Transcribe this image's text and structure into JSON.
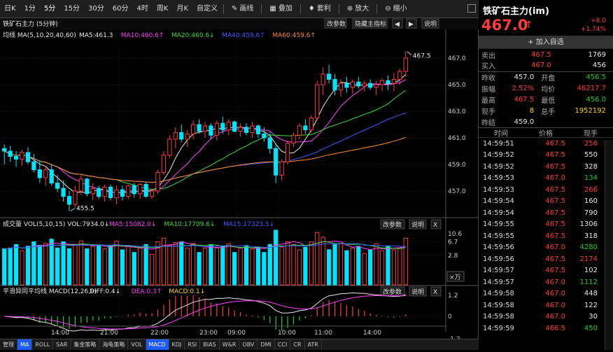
{
  "toolbar": {
    "periods": [
      "日K",
      "1分",
      "5分",
      "15分",
      "30分",
      "60分",
      "4时",
      "周K",
      "月K",
      "自定义"
    ],
    "active": "5分",
    "tools": [
      {
        "icon": "line-draw-icon",
        "label": "画线"
      },
      {
        "icon": "overlay-icon",
        "label": "叠加"
      },
      {
        "icon": "arbitrage-icon",
        "label": "套利"
      },
      {
        "icon": "zoom-in-icon",
        "label": "放大"
      },
      {
        "icon": "zoom-out-icon",
        "label": "缩小"
      }
    ]
  },
  "main_panel": {
    "title": "铁矿石主力 (5分钟)",
    "buttons": [
      "改参数",
      "隐藏主指标",
      "说明"
    ],
    "ma_legend": {
      "name": "均线 MA(5,10,20,40,60)",
      "items": [
        {
          "label": "MA5:461.3",
          "color": "#e8e8e8"
        },
        {
          "label": "MA10:460.6↑",
          "color": "#ff40ff"
        },
        {
          "label": "MA20:460.6↓",
          "color": "#3cdc3c"
        },
        {
          "label": "MA40:459.6↑",
          "color": "#3d5bff"
        },
        {
          "label": "MA60:459.6↑",
          "color": "#ff8c2a"
        }
      ]
    },
    "yticks": [
      "467.0",
      "465.0",
      "463.0",
      "461.0",
      "459.0",
      "457.0"
    ],
    "high_label": "467.5",
    "low_label": "455.5"
  },
  "vol_panel": {
    "title": "成交量 VOL(5,10,15) VOL:7934.0↓",
    "items": [
      {
        "label": "MA5:15082.0↓",
        "color": "#ff40ff"
      },
      {
        "label": "MA10:17709.6↓",
        "color": "#3cdc3c"
      },
      {
        "label": "MA15:17323.5↓",
        "color": "#3d5bff"
      }
    ],
    "buttons": [
      "改参数",
      "说明",
      "X"
    ],
    "yticks": [
      "10.6",
      "6.7",
      "2.8"
    ],
    "unit": "×万"
  },
  "macd_panel": {
    "title": "平滑异同平均线 MACD(12,26,9)",
    "items": [
      {
        "label": "DIFF:0.4↓",
        "color": "#e8e8e8"
      },
      {
        "label": "DEA:0.3↑",
        "color": "#ff40ff"
      },
      {
        "label": "MACD:0.1↓",
        "color": "#ffd200"
      }
    ],
    "buttons": [
      "改参数",
      "说明",
      "X"
    ],
    "yticks": [
      "1.2",
      "0",
      "-1.2"
    ]
  },
  "xticks": [
    "14:00",
    "21:00",
    "22:00",
    "23:00",
    "09:00",
    "10:00",
    "11:00",
    "14:00"
  ],
  "bottom_tabs": [
    "管理",
    "MA",
    "ROLL",
    "SAR",
    "集金策略",
    "海龟策略",
    "VOL",
    "MACD",
    "KDJ",
    "RSI",
    "BIAS",
    "W&R",
    "OBV",
    "DMI",
    "CCI",
    "CR",
    "ATR"
  ],
  "bottom_active": [
    "MA",
    "MACD"
  ],
  "chart_data": {
    "type": "candlestick",
    "title": "铁矿石主力 (5分钟)",
    "candles": [
      [
        460.2,
        460.5,
        459.0,
        460.0
      ],
      [
        460.0,
        460.4,
        459.2,
        459.6
      ],
      [
        459.6,
        460.0,
        458.8,
        459.4
      ],
      [
        459.4,
        460.1,
        458.9,
        459.9
      ],
      [
        459.9,
        460.3,
        459.0,
        459.2
      ],
      [
        459.2,
        459.8,
        458.4,
        458.6
      ],
      [
        458.6,
        459.3,
        457.6,
        458.0
      ],
      [
        458.0,
        458.9,
        457.4,
        458.6
      ],
      [
        458.6,
        459.0,
        457.4,
        457.6
      ],
      [
        457.6,
        458.2,
        456.9,
        457.2
      ],
      [
        457.2,
        457.8,
        456.2,
        456.6
      ],
      [
        456.6,
        457.0,
        455.5,
        456.0
      ],
      [
        456.0,
        457.4,
        455.8,
        457.0
      ],
      [
        457.0,
        458.3,
        456.7,
        457.9
      ],
      [
        457.9,
        458.0,
        456.6,
        456.8
      ],
      [
        456.8,
        457.6,
        456.3,
        457.2
      ],
      [
        457.2,
        457.4,
        456.4,
        456.6
      ],
      [
        456.6,
        457.5,
        456.2,
        457.3
      ],
      [
        457.3,
        457.5,
        456.3,
        456.5
      ],
      [
        456.5,
        457.4,
        456.0,
        457.1
      ],
      [
        457.1,
        457.4,
        456.3,
        456.6
      ],
      [
        456.6,
        457.5,
        456.4,
        457.4
      ],
      [
        457.4,
        457.6,
        456.5,
        456.8
      ],
      [
        456.8,
        457.6,
        456.4,
        457.5
      ],
      [
        457.5,
        457.7,
        456.5,
        456.6
      ],
      [
        456.6,
        457.2,
        456.4,
        457.0
      ],
      [
        457.0,
        458.6,
        456.8,
        458.4
      ],
      [
        458.4,
        460.0,
        458.2,
        459.7
      ],
      [
        459.7,
        461.2,
        459.5,
        460.9
      ],
      [
        460.9,
        461.8,
        460.2,
        461.4
      ],
      [
        461.4,
        462.0,
        460.7,
        460.9
      ],
      [
        460.9,
        461.6,
        460.3,
        461.3
      ],
      [
        461.3,
        462.3,
        460.9,
        462.0
      ],
      [
        462.0,
        462.4,
        461.3,
        461.5
      ],
      [
        461.5,
        462.2,
        461.0,
        461.9
      ],
      [
        461.9,
        462.1,
        460.9,
        461.2
      ],
      [
        461.2,
        462.3,
        460.8,
        462.1
      ],
      [
        462.1,
        462.6,
        461.3,
        461.6
      ],
      [
        461.6,
        462.4,
        461.2,
        462.2
      ],
      [
        462.2,
        462.3,
        461.4,
        461.5
      ],
      [
        461.5,
        462.1,
        461.1,
        461.8
      ],
      [
        461.8,
        462.1,
        461.2,
        461.4
      ],
      [
        461.4,
        462.2,
        461.0,
        461.9
      ],
      [
        461.9,
        462.0,
        461.0,
        461.3
      ],
      [
        461.3,
        461.8,
        460.7,
        461.0
      ],
      [
        461.0,
        461.4,
        459.8,
        460.2
      ],
      [
        460.2,
        460.6,
        457.6,
        458.2
      ],
      [
        458.2,
        459.4,
        457.8,
        459.2
      ],
      [
        459.2,
        460.8,
        459.0,
        460.6
      ],
      [
        460.6,
        461.4,
        460.3,
        461.2
      ],
      [
        461.2,
        462.1,
        460.9,
        461.9
      ],
      [
        461.9,
        462.4,
        461.3,
        461.6
      ],
      [
        461.6,
        462.7,
        461.4,
        462.5
      ],
      [
        462.5,
        465.3,
        462.3,
        465.0
      ],
      [
        465.0,
        466.3,
        464.2,
        465.8
      ],
      [
        465.8,
        466.5,
        465.1,
        465.4
      ],
      [
        465.4,
        465.8,
        464.2,
        464.6
      ],
      [
        464.6,
        465.4,
        464.1,
        465.1
      ],
      [
        465.1,
        465.6,
        464.4,
        464.8
      ],
      [
        464.8,
        465.4,
        464.3,
        465.2
      ],
      [
        465.2,
        465.6,
        464.7,
        464.9
      ],
      [
        464.9,
        465.3,
        464.5,
        465.1
      ],
      [
        465.1,
        465.4,
        464.6,
        464.8
      ],
      [
        464.8,
        465.3,
        464.2,
        465.0
      ],
      [
        465.0,
        465.5,
        464.5,
        465.3
      ],
      [
        465.3,
        465.7,
        464.6,
        465.1
      ],
      [
        465.1,
        465.9,
        464.5,
        465.4
      ],
      [
        465.4,
        466.2,
        465.0,
        466.0
      ],
      [
        466.0,
        467.5,
        465.6,
        467.0
      ]
    ],
    "ylim": [
      455.0,
      468.0
    ],
    "vol_ylim": [
      0,
      10.6
    ],
    "macd_ylim": [
      -1.2,
      1.2
    ]
  },
  "quote": {
    "name": "铁矿石主力(im)",
    "price": "467.0",
    "arrow": "↑",
    "change": "+8.0",
    "change_pct": "+1.74%",
    "add_fav": "+ 加入自选",
    "book": [
      {
        "label": "卖出",
        "price": "467.5",
        "vol": "1769"
      },
      {
        "label": "买入",
        "price": "467.0",
        "vol": "456"
      }
    ],
    "stats": [
      {
        "l1": "昨收",
        "v1": "457.0",
        "c1": "wh",
        "l2": "开盘",
        "v2": "456.5",
        "c2": "green"
      },
      {
        "l1": "振幅",
        "v1": "2.52%",
        "c1": "red",
        "l2": "均价",
        "v2": "46217.7",
        "c2": "red"
      },
      {
        "l1": "最高",
        "v1": "467.5",
        "c1": "red",
        "l2": "最低",
        "v2": "456.0",
        "c2": "green"
      },
      {
        "l1": "现手",
        "v1": "8",
        "c1": "yel",
        "l2": "总手",
        "v2": "1952192",
        "c2": "yel"
      },
      {
        "l1": "昨结",
        "v1": "459.0",
        "c1": "wh",
        "l2": "",
        "v2": "",
        "c2": "wh"
      }
    ],
    "tick_header": [
      "时间",
      "价格",
      "现手"
    ],
    "ticks": [
      {
        "t": "14:59:51",
        "p": "467.5",
        "v": "256",
        "pc": "red",
        "vc": "red"
      },
      {
        "t": "14:59:52",
        "p": "467.5",
        "v": "550",
        "pc": "red",
        "vc": "wh"
      },
      {
        "t": "14:59:52",
        "p": "467.5",
        "v": "328",
        "pc": "red",
        "vc": "wh"
      },
      {
        "t": "14:59:53",
        "p": "467.0",
        "v": "134",
        "pc": "red",
        "vc": "green"
      },
      {
        "t": "14:59:53",
        "p": "467.5",
        "v": "266",
        "pc": "red",
        "vc": "red"
      },
      {
        "t": "14:59:54",
        "p": "467.5",
        "v": "160",
        "pc": "red",
        "vc": "wh"
      },
      {
        "t": "14:59:54",
        "p": "467.5",
        "v": "790",
        "pc": "red",
        "vc": "wh"
      },
      {
        "t": "14:59:55",
        "p": "467.5",
        "v": "1306",
        "pc": "red",
        "vc": "wh"
      },
      {
        "t": "14:59:55",
        "p": "467.5",
        "v": "318",
        "pc": "red",
        "vc": "wh"
      },
      {
        "t": "14:59:56",
        "p": "467.0",
        "v": "4280",
        "pc": "red",
        "vc": "green"
      },
      {
        "t": "14:59:56",
        "p": "467.5",
        "v": "2174",
        "pc": "red",
        "vc": "red"
      },
      {
        "t": "14:59:57",
        "p": "467.5",
        "v": "102",
        "pc": "red",
        "vc": "wh"
      },
      {
        "t": "14:59:57",
        "p": "467.0",
        "v": "1112",
        "pc": "red",
        "vc": "green"
      },
      {
        "t": "14:59:58",
        "p": "467.0",
        "v": "448",
        "pc": "red",
        "vc": "wh"
      },
      {
        "t": "14:59:58",
        "p": "467.0",
        "v": "122",
        "pc": "red",
        "vc": "wh"
      },
      {
        "t": "14:59:58",
        "p": "467.0",
        "v": "30",
        "pc": "red",
        "vc": "wh"
      },
      {
        "t": "14:59:59",
        "p": "466.5",
        "v": "450",
        "pc": "red",
        "vc": "green"
      }
    ]
  }
}
